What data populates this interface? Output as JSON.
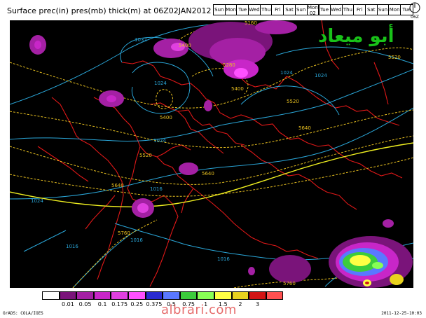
{
  "title": "Surface prec(in) pres(mb) thick(m) at 06Z02JAN2012",
  "days": [
    "Sun",
    "Mon",
    "Tue",
    "Wed",
    "Thu",
    "Fri",
    "Sat",
    "Sun",
    "Mon 02",
    "Tue",
    "Wed",
    "Thu",
    "Fri",
    "Sat",
    "Sun",
    "Mon",
    "Tue"
  ],
  "selected_day": "Mon 02",
  "gauge_label": "06Z",
  "logo_text": "أبو ميعاد",
  "colorbar": {
    "colors": [
      "#ffffff",
      "#7a147a",
      "#a420a4",
      "#c826c8",
      "#e040e0",
      "#ff50ff",
      "#2a2ad0",
      "#5a78ff",
      "#3ccc3c",
      "#88ff55",
      "#ffff44",
      "#e8d21e",
      "#d21414",
      "#ff5050"
    ],
    "labels": [
      "0.01",
      "0.05",
      "0.1",
      "0.175",
      "0.25",
      "0.375",
      "0.5",
      "0.75",
      "1",
      "1.5",
      "2",
      "3"
    ]
  },
  "contour_labels": {
    "pressure": [
      "1032",
      "1024",
      "1024",
      "1024",
      "1016",
      "1016",
      "1016",
      "1016",
      "1024",
      "1024"
    ],
    "thickness": [
      "5160",
      "5280",
      "5400",
      "5400",
      "5400",
      "5520",
      "5520",
      "5520",
      "5640",
      "5640",
      "5640",
      "5760",
      "5760"
    ]
  },
  "footer": {
    "left": "GrADS: COLA/IGES",
    "right": "2011-12-25-10:03"
  },
  "watermark": "albrari.com"
}
